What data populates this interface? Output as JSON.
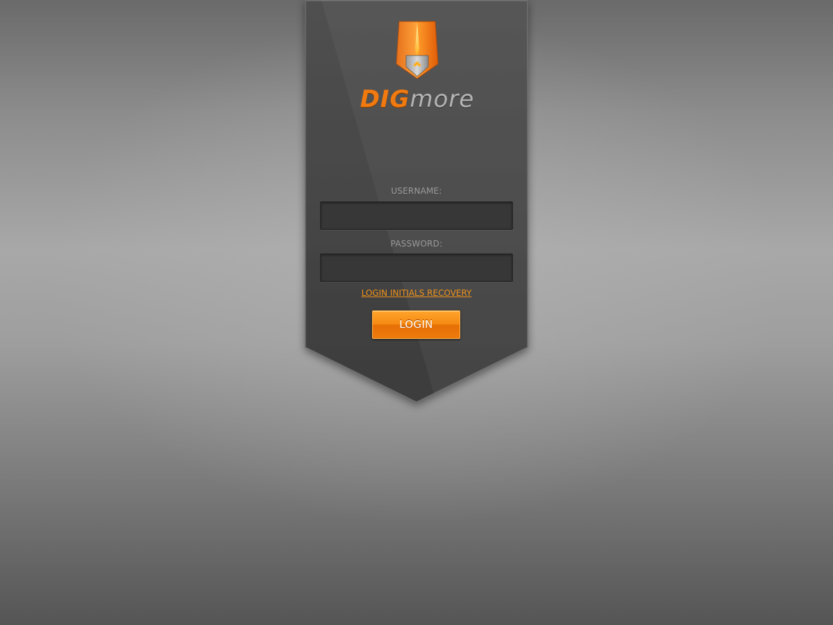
{
  "brand": {
    "name_part1": "DIG",
    "name_part2": "more",
    "emblem_icon": "shovel-shield-icon",
    "accent_color": "#f07a10"
  },
  "form": {
    "username_label": "USERNAME:",
    "username_value": "",
    "password_label": "PASSWORD:",
    "password_value": "",
    "recovery_link": "LOGIN INITIALS RECOVERY",
    "login_button": "LOGIN"
  }
}
